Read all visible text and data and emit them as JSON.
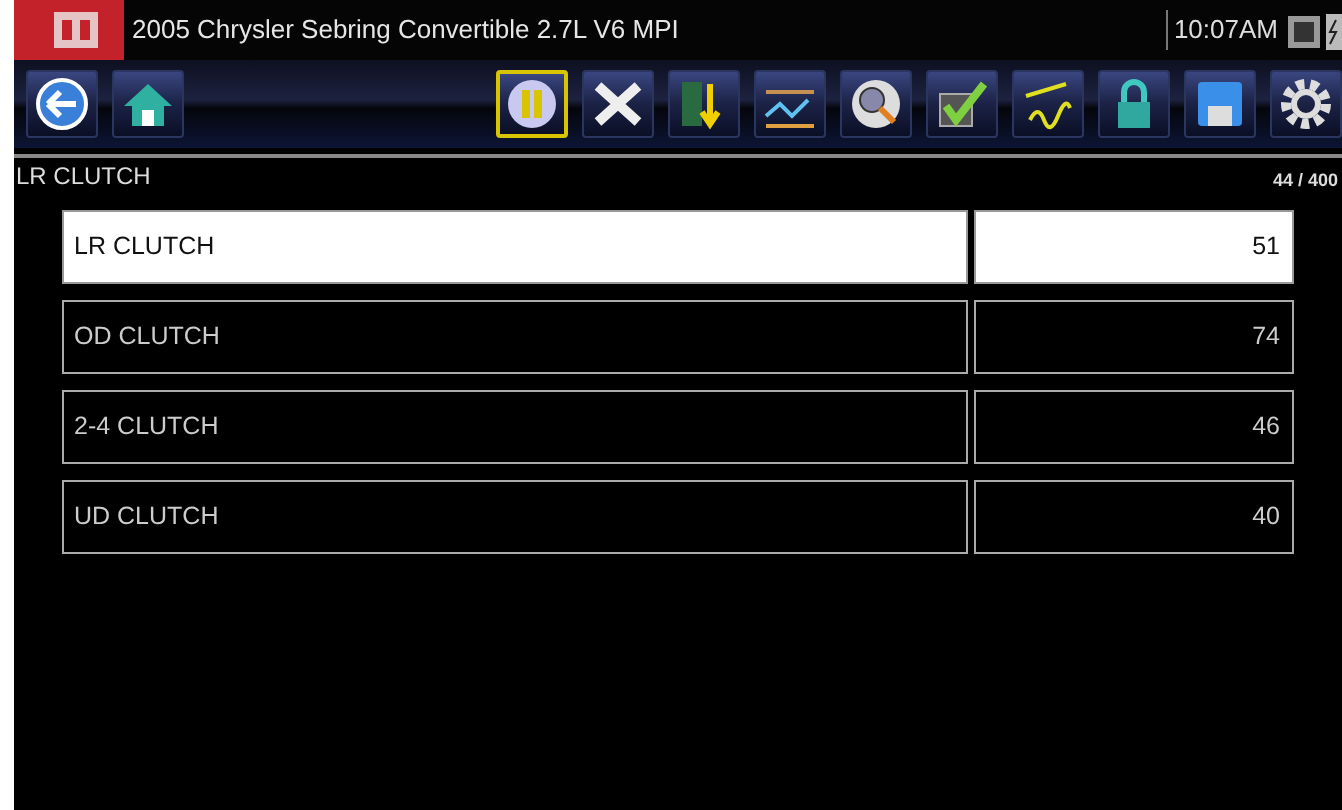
{
  "title_bar": {
    "title": "2005 Chrysler Sebring Convertible 2.7L V6 MPI",
    "time": "10:07AM"
  },
  "toolbar": {
    "left": [
      {
        "kind": "back",
        "selected": false
      },
      {
        "kind": "home",
        "selected": false
      }
    ],
    "right": [
      {
        "kind": "pause",
        "selected": true
      },
      {
        "kind": "close",
        "selected": false
      },
      {
        "kind": "sort",
        "selected": false
      },
      {
        "kind": "graph",
        "selected": false
      },
      {
        "kind": "zoom",
        "selected": false
      },
      {
        "kind": "check",
        "selected": false
      },
      {
        "kind": "meter",
        "selected": false
      },
      {
        "kind": "lock",
        "selected": false
      },
      {
        "kind": "save",
        "selected": false
      },
      {
        "kind": "settings",
        "selected": false
      }
    ]
  },
  "header": {
    "label": "LR CLUTCH",
    "count": "44 / 400"
  },
  "rows": [
    {
      "name": "LR CLUTCH",
      "value": "51",
      "selected": true
    },
    {
      "name": "OD CLUTCH",
      "value": "74",
      "selected": false
    },
    {
      "name": "2-4 CLUTCH",
      "value": "46",
      "selected": false
    },
    {
      "name": "UD CLUTCH",
      "value": "40",
      "selected": false
    }
  ]
}
